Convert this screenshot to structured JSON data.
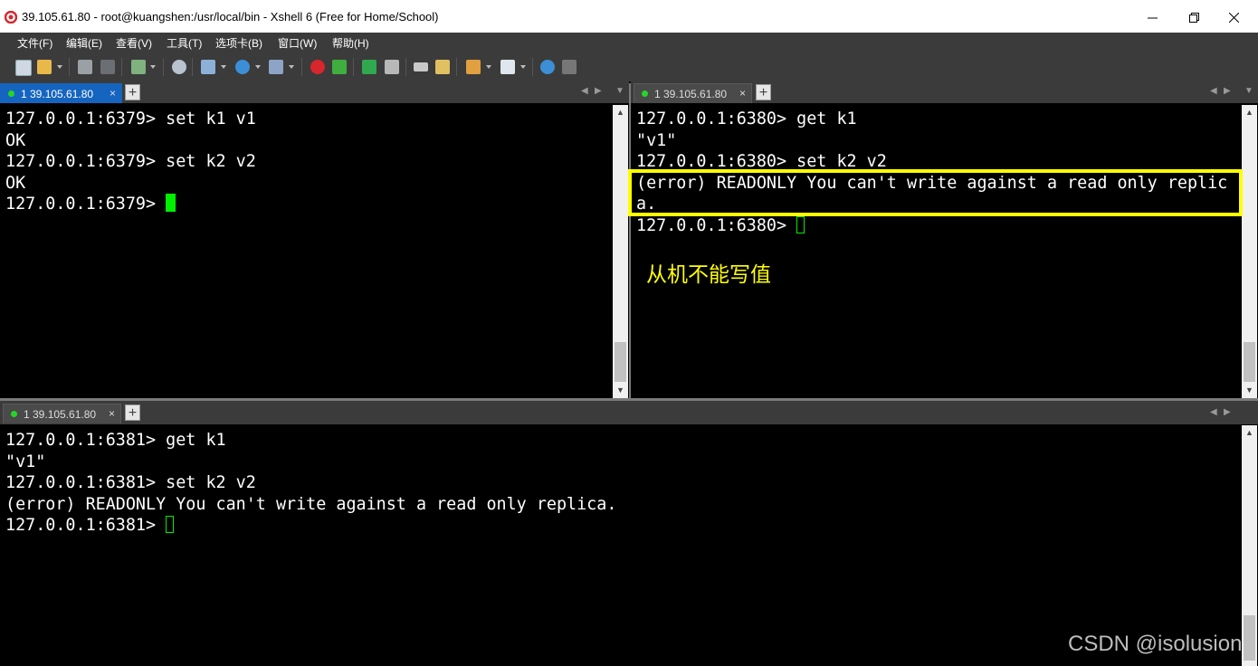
{
  "window": {
    "title": "39.105.61.80 - root@kuangshen:/usr/local/bin - Xshell 6 (Free for Home/School)"
  },
  "menu": [
    "文件(F)",
    "编辑(E)",
    "查看(V)",
    "工具(T)",
    "选项卡(B)",
    "窗口(W)",
    "帮助(H)"
  ],
  "toolbar_icons": [
    "new-session-icon",
    "open-folder-icon",
    "connect-icon",
    "disconnect-icon",
    "new-window-icon",
    "find-icon",
    "properties-icon",
    "globe-icon",
    "font-icon",
    "xshell-icon",
    "xftp-icon",
    "fullscreen-icon",
    "lock-icon",
    "keyboard-icon",
    "compose-icon",
    "script-icon",
    "layout-icon",
    "help-icon",
    "chat-icon"
  ],
  "panes": {
    "top_left": {
      "tab_label": "1 39.105.61.80",
      "close": "×",
      "add": "+",
      "lines": [
        "127.0.0.1:6379> set k1 v1",
        "OK",
        "127.0.0.1:6379> set k2 v2",
        "OK"
      ],
      "prompt": "127.0.0.1:6379> "
    },
    "top_right": {
      "tab_label": "1 39.105.61.80",
      "close": "×",
      "add": "+",
      "lines": [
        "127.0.0.1:6380> get k1",
        "\"v1\"",
        "127.0.0.1:6380> set k2 v2",
        "(error) READONLY You can't write against a read only replic",
        "a."
      ],
      "prompt": "127.0.0.1:6380> ",
      "annotation": "从机不能写值"
    },
    "bottom": {
      "tab_label": "1 39.105.61.80",
      "close": "×",
      "add": "+",
      "lines": [
        "127.0.0.1:6381> get k1",
        "\"v1\"",
        "127.0.0.1:6381> set k2 v2",
        "(error) READONLY You can't write against a read only replica."
      ],
      "prompt": "127.0.0.1:6381> "
    }
  },
  "watermark": "CSDN @isolusion",
  "colors": {
    "cursor": "#00ee00",
    "highlight": "#ffff00",
    "active_tab": "#1565c0",
    "status_dot": "#27d427"
  }
}
